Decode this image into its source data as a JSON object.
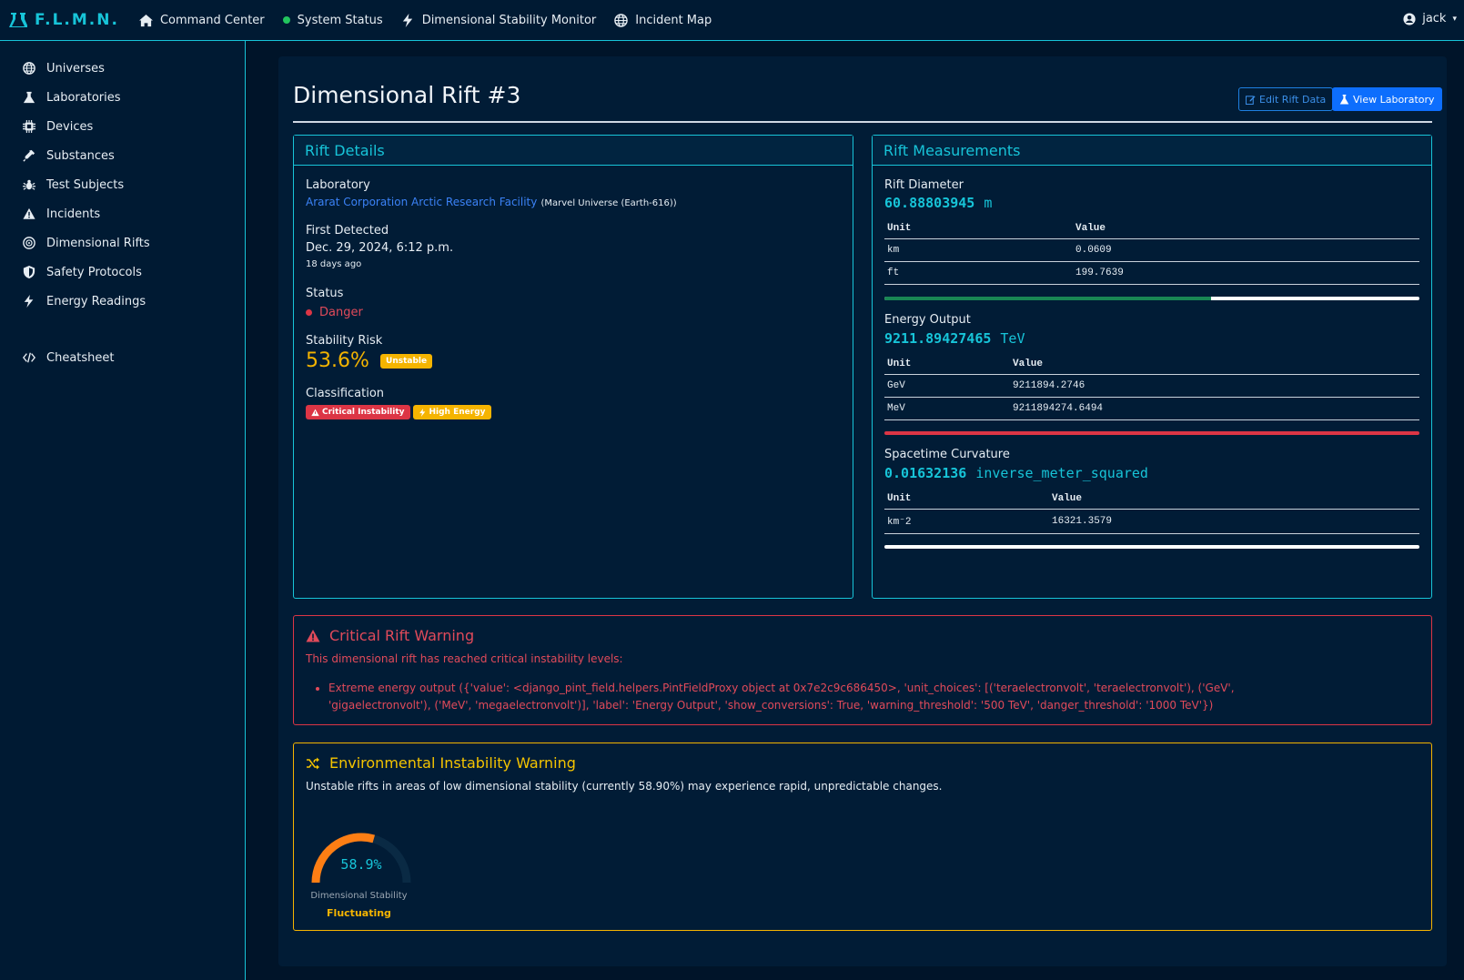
{
  "brand": {
    "name": "F.L.M.N."
  },
  "nav": {
    "items": [
      {
        "label": "Command Center",
        "icon": "home-icon"
      },
      {
        "label": "System Status",
        "icon": "status-dot-icon"
      },
      {
        "label": "Dimensional Stability Monitor",
        "icon": "bolt-icon"
      },
      {
        "label": "Incident Map",
        "icon": "globe-icon"
      }
    ],
    "user": "jack"
  },
  "sidebar": {
    "items": [
      {
        "label": "Universes",
        "icon": "globe-icon"
      },
      {
        "label": "Laboratories",
        "icon": "flask-icon"
      },
      {
        "label": "Devices",
        "icon": "chip-icon"
      },
      {
        "label": "Substances",
        "icon": "syringe-icon"
      },
      {
        "label": "Test Subjects",
        "icon": "bug-icon"
      },
      {
        "label": "Incidents",
        "icon": "warning-icon"
      },
      {
        "label": "Dimensional Rifts",
        "icon": "atom-icon"
      },
      {
        "label": "Safety Protocols",
        "icon": "shield-icon"
      },
      {
        "label": "Energy Readings",
        "icon": "bolt-icon"
      }
    ],
    "cheatsheet": "Cheatsheet"
  },
  "page": {
    "title": "Dimensional Rift #3",
    "edit_button": "Edit Rift Data",
    "view_button": "View Laboratory"
  },
  "details": {
    "heading": "Rift Details",
    "laboratory_label": "Laboratory",
    "laboratory_link": "Ararat Corporation Arctic Research Facility",
    "laboratory_universe": "(Marvel Universe (Earth-616))",
    "first_detected_label": "First Detected",
    "first_detected": "Dec. 29, 2024, 6:12 p.m.",
    "first_detected_ago": "18 days ago",
    "status_label": "Status",
    "status": "Danger",
    "stability_risk_label": "Stability Risk",
    "stability_risk": "53.6%",
    "stability_badge": "Unstable",
    "classification_label": "Classification",
    "classifications": [
      "Critical Instability",
      "High Energy"
    ]
  },
  "measurements": {
    "heading": "Rift Measurements",
    "colors": {
      "success": "#198754",
      "danger": "#dc3545"
    },
    "diameter": {
      "label": "Rift Diameter",
      "value": "60.88803945",
      "unit": "m",
      "col_unit": "Unit",
      "col_value": "Value",
      "rows": [
        [
          "km",
          "0.0609"
        ],
        [
          "ft",
          "199.7639"
        ]
      ],
      "progress": 0.61
    },
    "energy": {
      "label": "Energy Output",
      "value": "9211.89427465",
      "unit": "TeV",
      "col_unit": "Unit",
      "col_value": "Value",
      "rows": [
        [
          "GeV",
          "9211894.2746"
        ],
        [
          "MeV",
          "9211894274.6494"
        ]
      ],
      "progress": 1.0
    },
    "curvature": {
      "label": "Spacetime Curvature",
      "value": "0.01632136",
      "unit": "inverse_meter_squared",
      "col_unit": "Unit",
      "col_value": "Value",
      "rows": [
        [
          "km⁻2",
          "16321.3579"
        ]
      ],
      "progress": 0.0
    }
  },
  "critical_warning": {
    "title": "Critical Rift Warning",
    "text": "This dimensional rift has reached critical instability levels:",
    "items": [
      "Extreme energy output ({'value': <django_pint_field.helpers.PintFieldProxy object at 0x7e2c9c686450>, 'unit_choices': [('teraelectronvolt', 'teraelectronvolt'), ('GeV', 'gigaelectronvolt'), ('MeV', 'megaelectronvolt')], 'label': 'Energy Output', 'show_conversions': True, 'warning_threshold': '500 TeV', 'danger_threshold': '1000 TeV'})"
    ]
  },
  "env_warning": {
    "title": "Environmental Instability Warning",
    "text": "Unstable rifts in areas of low dimensional stability (currently 58.90%) may experience rapid, unpredictable changes.",
    "gauge_value": "58.9%",
    "gauge_fraction": 0.589,
    "gauge_label": "Dimensional Stability",
    "gauge_status": "Fluctuating"
  }
}
